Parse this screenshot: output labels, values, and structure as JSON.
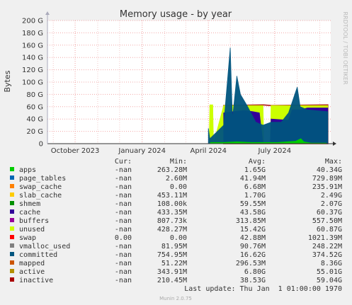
{
  "chart_data": {
    "type": "area",
    "title": "Memory usage - by year",
    "ylabel": "Bytes",
    "side_label": "RRDTOOL / TOBI OETIKER",
    "ylim": [
      0,
      200
    ],
    "y_unit": "G",
    "y_ticks": [
      0,
      20,
      40,
      60,
      80,
      100,
      120,
      140,
      160,
      180,
      200
    ],
    "y_tick_labels": [
      "0",
      "20 G",
      "40 G",
      "60 G",
      "80 G",
      "100 G",
      "120 G",
      "140 G",
      "160 G",
      "180 G",
      "200 G"
    ],
    "x_domain": [
      "2023-08-24",
      "2024-09-16"
    ],
    "x_ticks": [
      {
        "date": "2023-10-01",
        "label": "October 2023"
      },
      {
        "date": "2024-01-01",
        "label": "January 2024"
      },
      {
        "date": "2024-04-01",
        "label": "April 2024"
      },
      {
        "date": "2024-07-01",
        "label": "July 2024"
      }
    ],
    "grid": true,
    "series": [
      {
        "name": "apps",
        "color": "#00cc00",
        "points": [
          [
            "2024-04-03",
            0
          ],
          [
            "2024-04-04",
            2
          ],
          [
            "2024-04-20",
            2
          ],
          [
            "2024-05-10",
            3
          ],
          [
            "2024-05-30",
            2
          ],
          [
            "2024-07-05",
            2
          ],
          [
            "2024-07-30",
            4
          ],
          [
            "2024-08-06",
            8
          ],
          [
            "2024-08-10",
            3
          ],
          [
            "2024-08-20",
            1
          ],
          [
            "2024-09-10",
            1
          ]
        ]
      },
      {
        "name": "cache",
        "color": "#330099",
        "points": [
          [
            "2024-04-22",
            50
          ],
          [
            "2024-05-05",
            52
          ],
          [
            "2024-05-20",
            54
          ],
          [
            "2024-06-01",
            52
          ],
          [
            "2024-06-10",
            50
          ],
          [
            "2024-06-15",
            0
          ],
          [
            "2024-06-25",
            0
          ],
          [
            "2024-06-26",
            40
          ],
          [
            "2024-07-20",
            38
          ],
          [
            "2024-07-25",
            55
          ],
          [
            "2024-08-05",
            55
          ],
          [
            "2024-08-15",
            58
          ],
          [
            "2024-09-12",
            58
          ]
        ]
      },
      {
        "name": "unused",
        "color": "#ccff00",
        "points": [
          [
            "2024-04-02",
            0
          ],
          [
            "2024-04-03",
            63
          ],
          [
            "2024-04-07",
            63
          ],
          [
            "2024-04-08",
            0
          ],
          [
            "2024-04-22",
            62
          ],
          [
            "2024-06-15",
            62
          ],
          [
            "2024-06-16",
            0
          ],
          [
            "2024-06-25",
            0
          ],
          [
            "2024-06-26",
            62
          ],
          [
            "2024-09-12",
            62
          ]
        ]
      },
      {
        "name": "committed",
        "color": "#00557f",
        "points": [
          [
            "2024-04-01",
            25
          ],
          [
            "2024-04-03",
            8
          ],
          [
            "2024-04-22",
            30
          ],
          [
            "2024-05-01",
            156
          ],
          [
            "2024-05-04",
            40
          ],
          [
            "2024-05-10",
            110
          ],
          [
            "2024-05-15",
            80
          ],
          [
            "2024-05-25",
            60
          ],
          [
            "2024-06-05",
            35
          ],
          [
            "2024-06-15",
            30
          ],
          [
            "2024-06-26",
            35
          ],
          [
            "2024-07-10",
            35
          ],
          [
            "2024-07-20",
            50
          ],
          [
            "2024-08-01",
            92
          ],
          [
            "2024-08-05",
            60
          ],
          [
            "2024-08-15",
            55
          ],
          [
            "2024-09-12",
            52
          ]
        ]
      },
      {
        "name": "inactive",
        "color": "#aa0000",
        "points": [
          [
            "2024-04-22",
            62
          ],
          [
            "2024-06-15",
            63
          ],
          [
            "2024-06-26",
            62
          ],
          [
            "2024-09-12",
            63
          ]
        ]
      }
    ],
    "legend_headers": [
      "Cur:",
      "Min:",
      "Avg:",
      "Max:"
    ],
    "legend": [
      {
        "name": "apps",
        "color": "#00cc00",
        "cur": "-nan",
        "min": "263.28M",
        "avg": "1.65G",
        "max": "40.34G"
      },
      {
        "name": "page_tables",
        "color": "#0066b3",
        "cur": "-nan",
        "min": "2.60M",
        "avg": "41.94M",
        "max": "729.89M"
      },
      {
        "name": "swap_cache",
        "color": "#ff8000",
        "cur": "-nan",
        "min": "0.00",
        "avg": "6.68M",
        "max": "235.91M"
      },
      {
        "name": "slab_cache",
        "color": "#ffcc00",
        "cur": "-nan",
        "min": "453.11M",
        "avg": "1.70G",
        "max": "2.49G"
      },
      {
        "name": "shmem",
        "color": "#008f00",
        "cur": "-nan",
        "min": "108.00k",
        "avg": "59.55M",
        "max": "2.07G"
      },
      {
        "name": "cache",
        "color": "#330099",
        "cur": "-nan",
        "min": "433.35M",
        "avg": "43.58G",
        "max": "60.37G"
      },
      {
        "name": "buffers",
        "color": "#990099",
        "cur": "-nan",
        "min": "807.73k",
        "avg": "313.85M",
        "max": "557.50M"
      },
      {
        "name": "unused",
        "color": "#ccff00",
        "cur": "-nan",
        "min": "428.27M",
        "avg": "15.42G",
        "max": "60.87G"
      },
      {
        "name": "swap",
        "color": "#ff0000",
        "cur": "0.00",
        "min": "0.00",
        "avg": "42.88M",
        "max": "1021.39M"
      },
      {
        "name": "vmalloc_used",
        "color": "#808080",
        "cur": "-nan",
        "min": "81.95M",
        "avg": "90.76M",
        "max": "248.22M"
      },
      {
        "name": "committed",
        "color": "#00557f",
        "cur": "-nan",
        "min": "754.95M",
        "avg": "16.62G",
        "max": "374.52G"
      },
      {
        "name": "mapped",
        "color": "#cc5500",
        "cur": "-nan",
        "min": "51.22M",
        "avg": "296.53M",
        "max": "8.36G"
      },
      {
        "name": "active",
        "color": "#b38f00",
        "cur": "-nan",
        "min": "343.91M",
        "avg": "6.80G",
        "max": "55.01G"
      },
      {
        "name": "inactive",
        "color": "#aa0000",
        "cur": "-nan",
        "min": "210.45M",
        "avg": "38.53G",
        "max": "59.04G"
      }
    ],
    "last_update": "Last update: Thu Jan  1 01:00:00 1970",
    "footer": "Munin 2.0.75"
  }
}
